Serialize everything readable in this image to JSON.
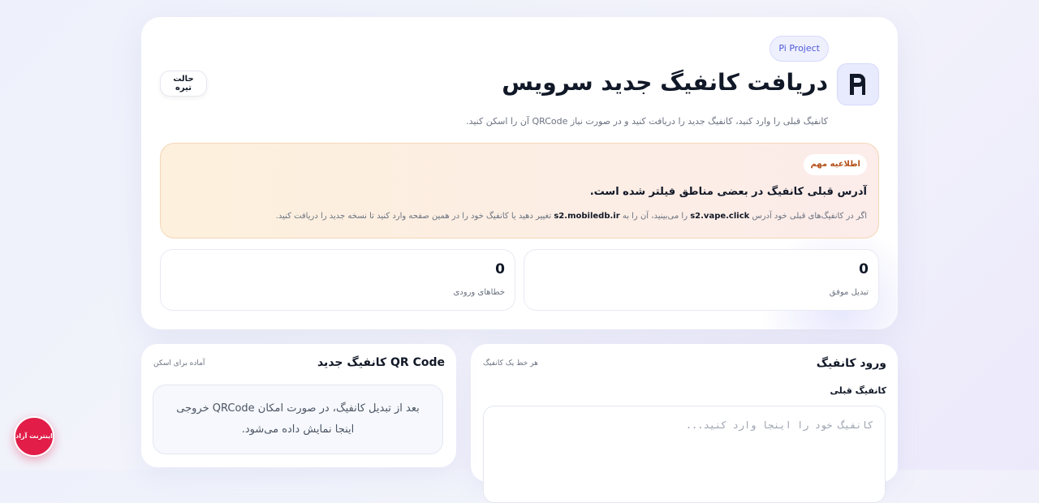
{
  "header": {
    "project_badge": "Pi Project",
    "title": "دریافت کانفیگ جدید سرویس",
    "subtitle": "کانفیگ قبلی را وارد کنید، کانفیگ جدید را دریافت کنید و در صورت نیاز QRCode آن را اسکن کنید.",
    "dark_mode_label": "حالت تیره"
  },
  "notice": {
    "badge": "اطلاعیه مهم",
    "title": "آدرس قبلی کانفیگ در بعضی مناطق فیلتر شده است.",
    "body_part1": "اگر در کانفیگ‌های قبلی خود آدرس",
    "old_address": "s2.vape.click",
    "body_part2": "را می‌بینید، آن را به",
    "new_address": "s2.mobiledb.ir",
    "body_part3": "تغییر دهید یا کانفیگ خود را در همین صفحه وارد کنید تا نسخه جدید را دریافت کنید."
  },
  "stats": [
    {
      "value": "0",
      "label": "تبدیل موفق"
    },
    {
      "value": "0",
      "label": "خطاهای ورودی"
    }
  ],
  "input_card": {
    "title": "ورود کانفیگ",
    "hint": "هر خط یک کانفیگ",
    "field_label": "کانفیگ قبلی",
    "placeholder": "کانفیگ خود را اینجا وارد کنید..."
  },
  "qr_card": {
    "title": "QR Code کانفیگ جدید",
    "status": "آماده برای اسکن",
    "empty_message": "بعد از تبدیل کانفیگ، در صورت امکان QRCode خروجی اینجا نمایش داده می‌شود."
  },
  "floating_badge": {
    "text": "اینترنت آزاد"
  },
  "colors": {
    "accent": "#4f5ad8",
    "notice_badge_text": "#b4501b",
    "floating_badge": "#e11d48"
  }
}
